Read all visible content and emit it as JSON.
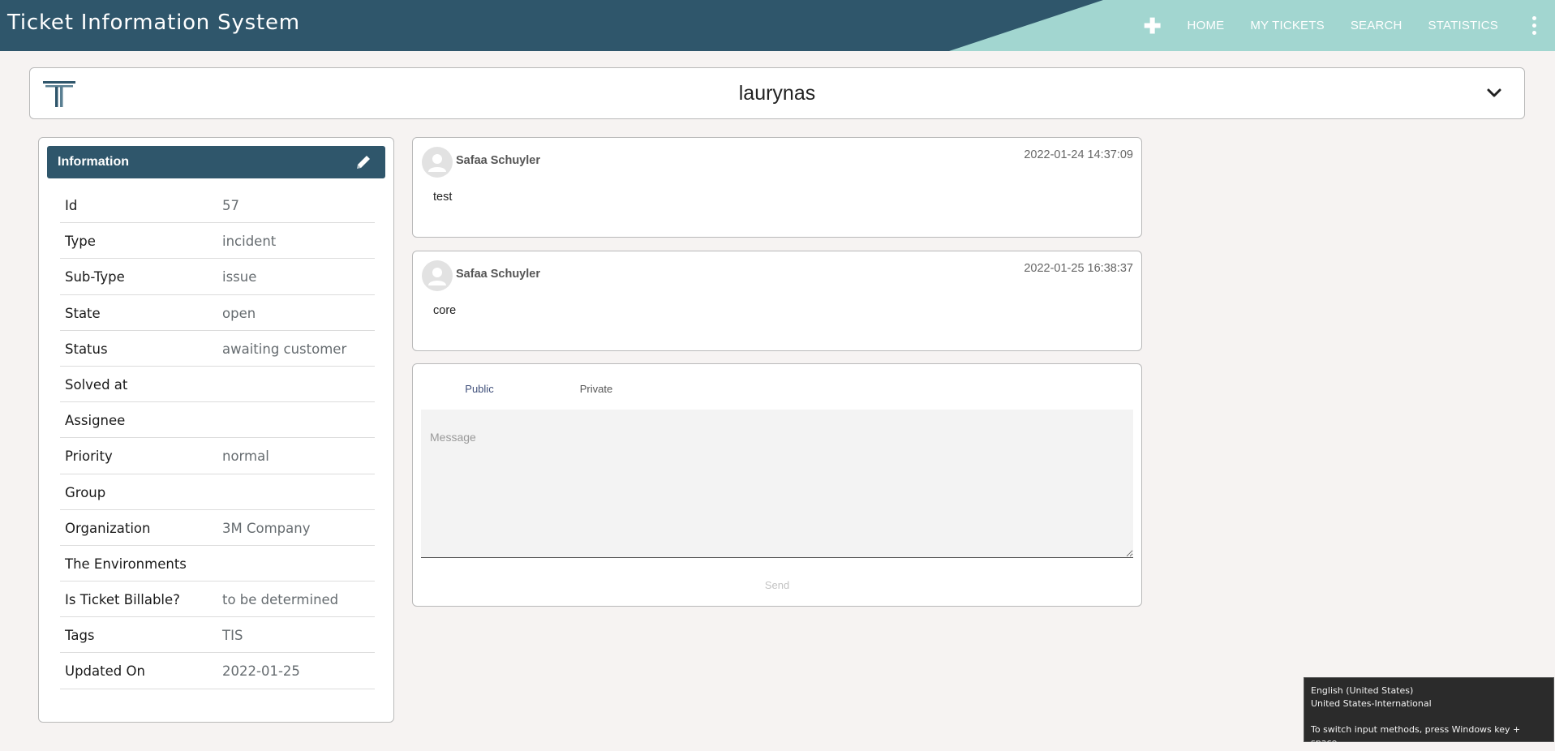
{
  "app": {
    "title": "Ticket Information System"
  },
  "nav": {
    "add_icon": "plus-icon",
    "items": [
      "HOME",
      "MY TICKETS",
      "SEARCH",
      "STATISTICS"
    ],
    "more_icon": "kebab-menu-icon"
  },
  "ticket": {
    "title": "laurynas"
  },
  "info": {
    "title": "Information",
    "rows": [
      {
        "label": "Id",
        "value": "57"
      },
      {
        "label": "Type",
        "value": "incident"
      },
      {
        "label": "Sub-Type",
        "value": "issue"
      },
      {
        "label": "State",
        "value": "open"
      },
      {
        "label": "Status",
        "value": "awaiting customer"
      },
      {
        "label": "Solved at",
        "value": ""
      },
      {
        "label": "Assignee",
        "value": ""
      },
      {
        "label": "Priority",
        "value": "normal"
      },
      {
        "label": "Group",
        "value": ""
      },
      {
        "label": "Organization",
        "value": "3M Company"
      },
      {
        "label": "The Environments",
        "value": ""
      },
      {
        "label": "Is Ticket Billable?",
        "value": "to be determined"
      },
      {
        "label": "Tags",
        "value": "TIS"
      },
      {
        "label": "Updated On",
        "value": "2022-01-25"
      }
    ]
  },
  "comments": [
    {
      "author": "Safaa Schuyler",
      "time": "2022-01-24 14:37:09",
      "body": "test"
    },
    {
      "author": "Safaa Schuyler",
      "time": "2022-01-25 16:38:37",
      "body": "core"
    }
  ],
  "compose": {
    "tabs": [
      "Public",
      "Private"
    ],
    "active_tab": "Public",
    "placeholder": "Message",
    "send_label": "Send"
  },
  "tooltip": {
    "line1": "English (United States)",
    "line2": "United States-International",
    "line3": "To switch input methods, press Windows key + space."
  },
  "colors": {
    "header": "#2f566b",
    "header_accent": "#a2d6d0",
    "tab_active": "#3a55c4",
    "background": "#f6f3f2"
  }
}
